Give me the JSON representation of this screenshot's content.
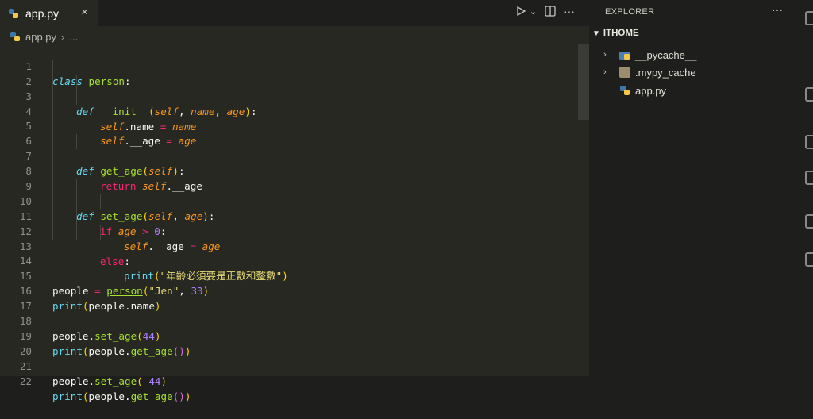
{
  "tab": {
    "filename": "app.py",
    "close_glyph": "×"
  },
  "toolbar": {
    "run_icon": "play-icon",
    "dropdown": "⌄",
    "split_icon": "split-editor-icon",
    "more": "···"
  },
  "breadcrumb": {
    "file": "app.py",
    "separator": "›",
    "more": "..."
  },
  "code": {
    "line_numbers": [
      "1",
      "2",
      "3",
      "4",
      "5",
      "6",
      "7",
      "8",
      "9",
      "10",
      "11",
      "12",
      "13",
      "14",
      "15",
      "16",
      "17",
      "18",
      "19",
      "20",
      "21",
      "22"
    ],
    "l1": {
      "kw": "class",
      "name": "person",
      "colon": ":"
    },
    "l2": {
      "kw": "def",
      "fn": "__init__",
      "open": "(",
      "self": "self",
      "c1": ", ",
      "p1": "name",
      "c2": ", ",
      "p2": "age",
      "close": ")",
      "colon": ":"
    },
    "l3": {
      "self": "self",
      "attr": ".name ",
      "eq": "=",
      "val": "name"
    },
    "l4": {
      "self": "self",
      "attr": ".__age ",
      "eq": "=",
      "val": "age"
    },
    "l6": {
      "kw": "def",
      "fn": "get_age",
      "open": "(",
      "self": "self",
      "close": ")",
      "colon": ":"
    },
    "l7": {
      "kw": "return",
      "self": "self",
      "attr": ".__age"
    },
    "l9": {
      "kw": "def",
      "fn": "set_age",
      "open": "(",
      "self": "self",
      "c1": ", ",
      "p1": "age",
      "close": ")",
      "colon": ":"
    },
    "l10": {
      "kw": "if",
      "var": "age",
      "op": ">",
      "num": "0",
      "colon": ":"
    },
    "l11": {
      "self": "self",
      "attr": ".__age ",
      "eq": "=",
      "val": "age"
    },
    "l12": {
      "kw": "else",
      "colon": ":"
    },
    "l13": {
      "fn": "print",
      "open": "(",
      "str": "\"年齡必須要是正數和整數\"",
      "close": ")"
    },
    "l15": {
      "var": "people ",
      "eq": "=",
      "cls": "person",
      "open": "(",
      "str": "\"Jen\"",
      "c": ", ",
      "num": "33",
      "close": ")"
    },
    "l16": {
      "fn": "print",
      "open": "(",
      "arg": "people.name",
      "close": ")"
    },
    "l18": {
      "obj": "people.",
      "fn": "set_age",
      "open": "(",
      "num": "44",
      "close": ")"
    },
    "l19": {
      "fn": "print",
      "open": "(",
      "obj": "people.",
      "fn2": "get_age",
      "inner": "()",
      "close": ")"
    },
    "l21": {
      "obj": "people.",
      "fn": "set_age",
      "open": "(",
      "op": "-",
      "num": "44",
      "close": ")"
    },
    "l22": {
      "fn": "print",
      "open": "(",
      "obj": "people.",
      "fn2": "get_age",
      "inner": "()",
      "close": ")"
    }
  },
  "explorer": {
    "title": "EXPLORER",
    "more": "···",
    "section": "ITHOME",
    "items": [
      {
        "label": "__pycache__",
        "icon": "python-folder-icon"
      },
      {
        "label": ".mypy_cache",
        "icon": "folder-icon"
      },
      {
        "label": "app.py",
        "icon": "python-file-icon"
      }
    ]
  },
  "colors": {
    "editor_bg": "#272822",
    "sidebar_bg": "#1e1f1c",
    "keyword": "#f92672",
    "function": "#a6e22e",
    "string": "#e6db74",
    "number": "#ae81ff",
    "parameter": "#fd971f"
  }
}
